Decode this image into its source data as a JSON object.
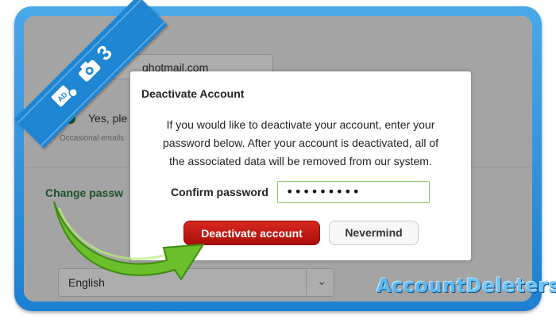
{
  "background": {
    "email_fragment": "ghotmail.com",
    "radio_label": "Yes, ple",
    "occasional_note": "Occasional emails",
    "change_password_link": "Change passw",
    "language": {
      "selected": "English"
    }
  },
  "modal": {
    "title": "Deactivate Account",
    "message_lines": [
      "If you would like to deactivate your account, enter your",
      "password below. After your account is deactivated, all of",
      "the associated data will be removed from our system."
    ],
    "password_label": "Confirm password",
    "password_value": "•••••••••",
    "deactivate_label": "Deactivate account",
    "nevermind_label": "Nevermind"
  },
  "overlay": {
    "step_number": "3",
    "logo_part1": "Account",
    "logo_part2": "Deleters",
    "colors": {
      "ribbon": "#1f86d3",
      "frame": "#1d7fd0",
      "arrow": "#6abf2a",
      "deactivate_button": "#c81b14"
    }
  }
}
